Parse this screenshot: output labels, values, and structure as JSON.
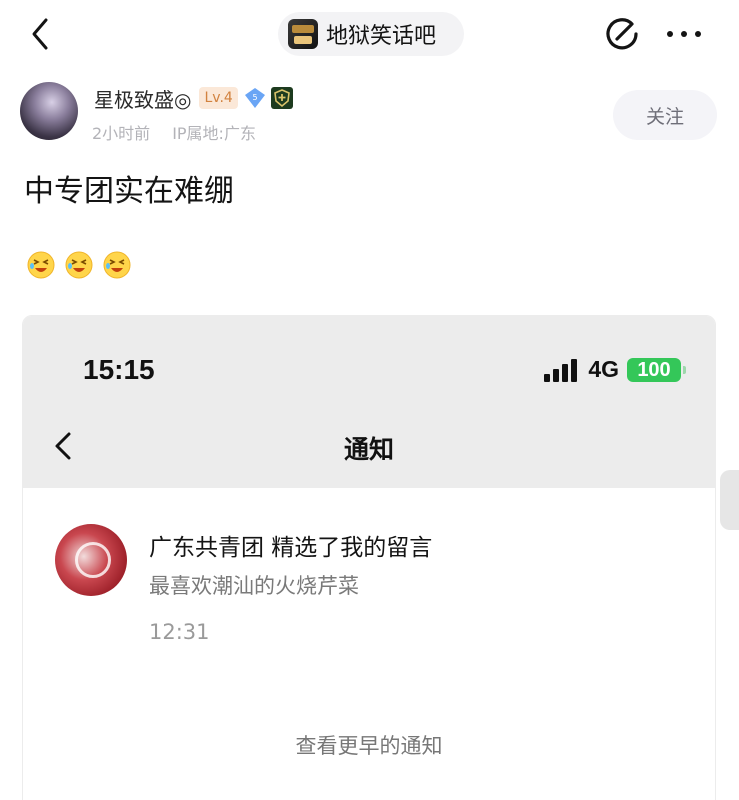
{
  "nav": {
    "forum_name": "地狱笑话吧",
    "back_icon": "chevron-left-icon",
    "edit_icon": "edit-icon",
    "more_icon": "more-dots-icon"
  },
  "post": {
    "username": "星极致盛◎",
    "level": "Lv.4",
    "diamond_number": "5",
    "time_ago": "2小时前",
    "ip_location": "IP属地:广东",
    "follow_label": "关注",
    "title": "中专团实在难绷",
    "emoji_count": 3
  },
  "embed": {
    "status_time": "15:15",
    "network": "4G",
    "battery": "100",
    "header_title": "通知",
    "notification": {
      "line1": "广东共青团 精选了我的留言",
      "line2": "最喜欢潮汕的火烧芹菜",
      "time": "12:31"
    },
    "view_earlier": "查看更早的通知"
  },
  "colors": {
    "level_badge_text": "#d2823f",
    "battery_green": "#34c759",
    "follow_bg": "#f4f4f8"
  }
}
